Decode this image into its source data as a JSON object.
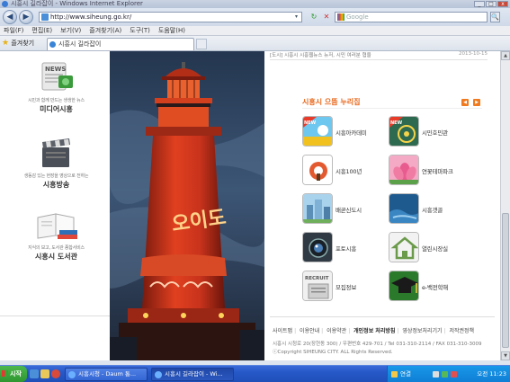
{
  "window": {
    "title": "시흥시 길라잡이 - Windows Internet Explorer",
    "buttons": [
      "_",
      "□",
      "x"
    ]
  },
  "address_bar": {
    "url": "http://www.siheung.go.kr/",
    "search_placeholder": "Google",
    "refresh": "↻",
    "stop": "✕",
    "search_btn": "🔍",
    "back": "◀",
    "forward": "▶",
    "dd": "▾"
  },
  "menu": [
    "파일(F)",
    "편집(E)",
    "보기(V)",
    "즐겨찾기(A)",
    "도구(T)",
    "도움말(H)"
  ],
  "favorites_label": "즐겨찾기",
  "tab_title": "시흥시 길라잡이",
  "left_services": [
    {
      "desc": "시민과 함께 만드는 생생한 뉴스",
      "name": "미디어시흥",
      "icon": "news-icon"
    },
    {
      "desc": "생동감 있는 현장을 영상으로 전하는",
      "name": "시흥방송",
      "icon": "clapperboard-icon"
    },
    {
      "desc": "지식의 보고, 도서관 종합서비스",
      "name": "시흥시 도서관",
      "icon": "books-icon"
    }
  ],
  "photo": {
    "sign_text": "오이도"
  },
  "news": {
    "category": "[도시]",
    "headline": "시흥시 시흥웹뉴스 뉴저, 시민 여러분 협을",
    "date": "2013-10-15"
  },
  "section": {
    "title": "시흥시 으뜸 누리집",
    "prev": "◀",
    "next": "▶",
    "items": [
      {
        "label": "시흥아카데미",
        "icon": "academy-icon",
        "badge": "NEW",
        "color": "#2f9ad8"
      },
      {
        "label": "시민호민관",
        "icon": "ombudsman-icon",
        "badge": "NEW",
        "color": "#2e7a5a"
      },
      {
        "label": "시흥100년",
        "icon": "history-100-icon",
        "badge": "",
        "color": "#d94a2b"
      },
      {
        "label": "연꽃테마파크",
        "icon": "lotus-icon",
        "badge": "",
        "color": "#d85a8a"
      },
      {
        "label": "배곧신도시",
        "icon": "new-city-icon",
        "badge": "",
        "color": "#5b9ec9"
      },
      {
        "label": "시흥갯골",
        "icon": "tidal-flat-icon",
        "badge": "",
        "color": "#3a78a8"
      },
      {
        "label": "포토시흥",
        "icon": "camera-icon",
        "badge": "",
        "color": "#333f4a"
      },
      {
        "label": "열린시장실",
        "icon": "mayor-office-icon",
        "badge": "",
        "color": "#7aa65a"
      },
      {
        "label": "모집정보",
        "icon": "recruit-icon",
        "badge": "RECRUIT",
        "color": "#666666"
      },
      {
        "label": "e-백전학해",
        "icon": "e-learning-icon",
        "badge": "",
        "color": "#2b7a2b"
      }
    ]
  },
  "footer": {
    "links": [
      "사이트맵",
      "이용안내",
      "이용약관",
      "개인정보 처리방침",
      "영상정보처리기기",
      "저작권정책"
    ],
    "address": "시흥시 시청로 20(장현동 300) / 우편번호 429-701 / Tel 031-310-2114 / FAX 031-310-3009",
    "copyright": "ⓒCopyright SIHEUNG CITY. ALL Rights Reserved."
  },
  "taskbar": {
    "start": "시작",
    "tasks": [
      "시흥시청 - Daum 통...",
      "시흥시 길라잡이 - Wi..."
    ],
    "lang": "연결",
    "clock": "오전 11:23"
  },
  "colors": {
    "accent": "#e8661a",
    "taskbar": "#2658c8",
    "tower": "#c8331c"
  }
}
